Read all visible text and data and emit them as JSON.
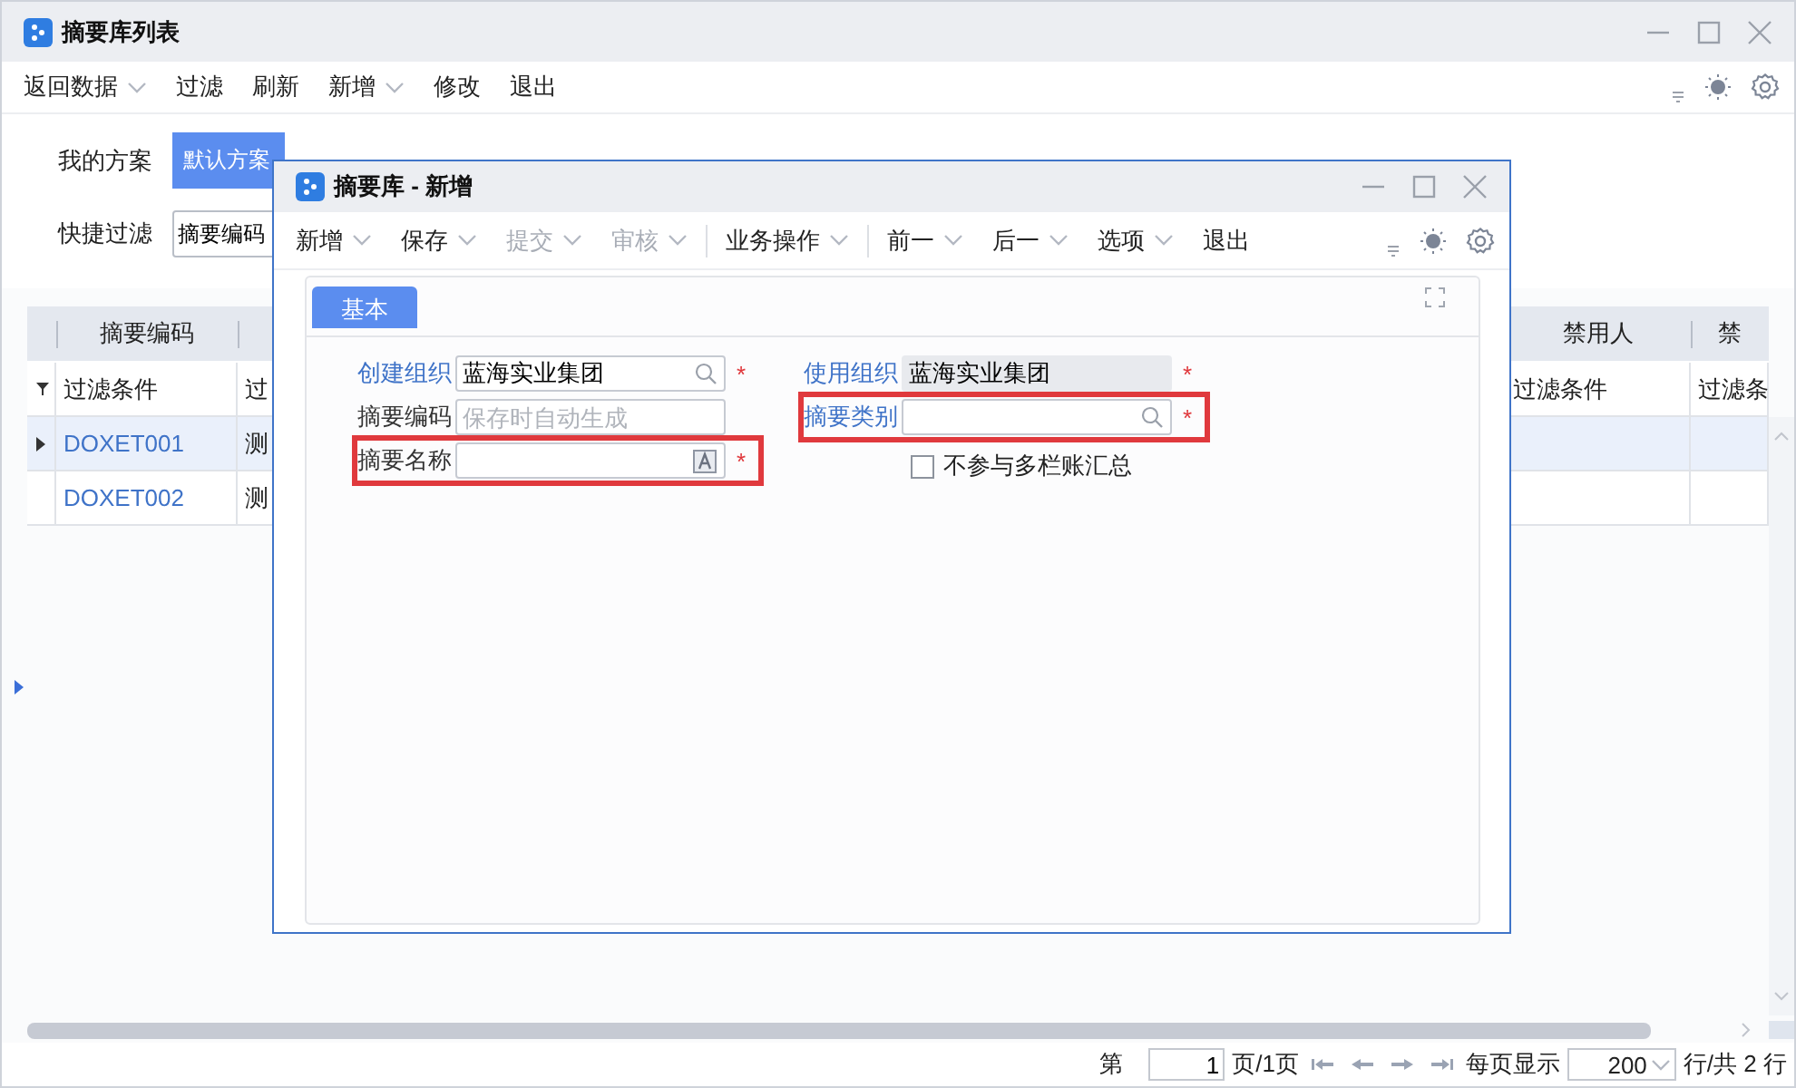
{
  "window": {
    "title": "摘要库列表"
  },
  "toolbar": [
    {
      "label": "返回数据",
      "dropdown": true
    },
    {
      "label": "过滤",
      "dropdown": false
    },
    {
      "label": "刷新",
      "dropdown": false
    },
    {
      "label": "新增",
      "dropdown": true
    },
    {
      "label": "修改",
      "dropdown": false
    },
    {
      "label": "退出",
      "dropdown": false
    }
  ],
  "schemes": {
    "label": "我的方案",
    "tabs": [
      {
        "label": "默认方案",
        "selected": true
      }
    ]
  },
  "quick_filter": {
    "label": "快捷过滤",
    "value": "摘要编码"
  },
  "table": {
    "columns": [
      {
        "header": "摘要编码",
        "filter": "过滤条件"
      },
      {
        "filter": "过"
      },
      {
        "header": "禁用人",
        "filter": "过滤条件"
      },
      {
        "header": "禁",
        "filter": "过滤条"
      }
    ],
    "rows": [
      {
        "selected": true,
        "cells": [
          "DOXET001",
          "测",
          null,
          null
        ]
      },
      {
        "selected": false,
        "cells": [
          "DOXET002",
          "测",
          null,
          null
        ]
      }
    ]
  },
  "pager": {
    "prefix": "第",
    "page": "1",
    "page_suffix": "页/1页",
    "page_size_label": "每页显示",
    "page_size": "200",
    "suffix": "行/共 2 行"
  },
  "dialog": {
    "title": "摘要库 - 新增",
    "toolbar": [
      {
        "label": "新增",
        "dropdown": true,
        "disabled": false,
        "group_end": false
      },
      {
        "label": "保存",
        "dropdown": true,
        "disabled": false,
        "group_end": false
      },
      {
        "label": "提交",
        "dropdown": true,
        "disabled": true,
        "group_end": false
      },
      {
        "label": "审核",
        "dropdown": true,
        "disabled": true,
        "group_end": true
      },
      {
        "label": "业务操作",
        "dropdown": true,
        "disabled": false,
        "group_end": true
      },
      {
        "label": "前一",
        "dropdown": true,
        "disabled": false,
        "group_end": false
      },
      {
        "label": "后一",
        "dropdown": true,
        "disabled": false,
        "group_end": false
      },
      {
        "label": "选项",
        "dropdown": true,
        "disabled": false,
        "group_end": false
      },
      {
        "label": "退出",
        "dropdown": false,
        "disabled": false,
        "group_end": false
      }
    ],
    "tabs": [
      {
        "label": "基本",
        "selected": true
      }
    ],
    "left_fields": [
      {
        "label": "创建组织",
        "kind": "lookup",
        "link": true,
        "value": "蓝海实业集团",
        "required_mark": "*",
        "highlighted": false
      },
      {
        "label": "摘要编码",
        "kind": "text",
        "link": false,
        "placeholder": "保存时自动生成",
        "highlighted": false
      },
      {
        "label": "摘要名称",
        "kind": "multilang",
        "link": false,
        "required_mark": "*",
        "highlighted": true
      }
    ],
    "right_fields": [
      {
        "label": "使用组织",
        "kind": "readonly",
        "link": true,
        "value": "蓝海实业集团",
        "required_mark": "*",
        "highlighted": false
      },
      {
        "label": "摘要类别",
        "kind": "lookup",
        "link": true,
        "required_mark": "*",
        "highlighted": true
      }
    ],
    "checkbox": {
      "label": "不参与多栏账汇总",
      "checked": false
    }
  }
}
